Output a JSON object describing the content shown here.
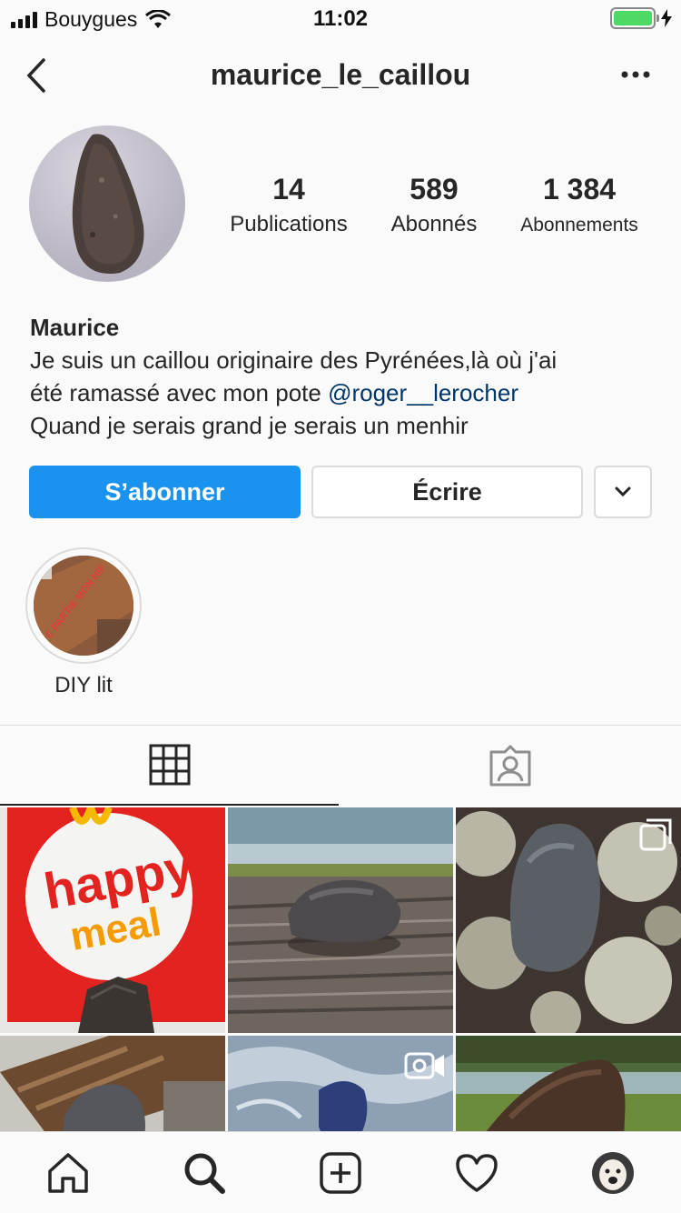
{
  "status_bar": {
    "carrier": "Bouygues",
    "time": "11:02",
    "battery_level": 1.0,
    "battery_color": "#4cd964"
  },
  "nav": {
    "username": "maurice_le_caillou",
    "back_icon": "chevron-left-icon",
    "more_icon": "ellipsis-icon"
  },
  "profile": {
    "stats": [
      {
        "value": "14",
        "label": "Publications"
      },
      {
        "value": "589",
        "label": "Abonnés"
      },
      {
        "value": "1 384",
        "label": "Abonnements"
      }
    ],
    "name": "Maurice",
    "bio_line1": "Je suis un caillou originaire des Pyrénées,là où j'ai",
    "bio_line2_prefix": "été ramassé avec mon pote ",
    "bio_mention": "@roger__lerocher",
    "bio_line3": "Quand je serais grand je serais un menhir"
  },
  "actions": {
    "follow_label": "S’abonner",
    "message_label": "Écrire",
    "more_icon": "chevron-down-icon",
    "follow_color": "#1a93f0"
  },
  "highlights": [
    {
      "label": "DIY lit",
      "sign_text": "C PARTIE MON HIF"
    }
  ],
  "tabs": [
    {
      "name": "grid",
      "icon": "grid-icon",
      "active": true
    },
    {
      "name": "tagged",
      "icon": "tagged-person-icon",
      "active": false
    }
  ],
  "posts": [
    {
      "subject": "happy-meal-box",
      "text_line1": "happy",
      "text_line2": "meal"
    },
    {
      "subject": "rock-on-wood"
    },
    {
      "subject": "rock-on-lichen",
      "badge_icon": "carousel-icon"
    },
    {
      "subject": "rock-on-bark"
    },
    {
      "subject": "rock-in-water",
      "badge_icon": "video-icon"
    },
    {
      "subject": "rock-by-lake"
    }
  ],
  "tab_bar": [
    {
      "name": "home",
      "icon": "home-icon"
    },
    {
      "name": "search",
      "icon": "search-icon"
    },
    {
      "name": "new-post",
      "icon": "plus-square-icon"
    },
    {
      "name": "activity",
      "icon": "heart-icon"
    },
    {
      "name": "profile",
      "icon": "profile-avatar-icon"
    }
  ]
}
